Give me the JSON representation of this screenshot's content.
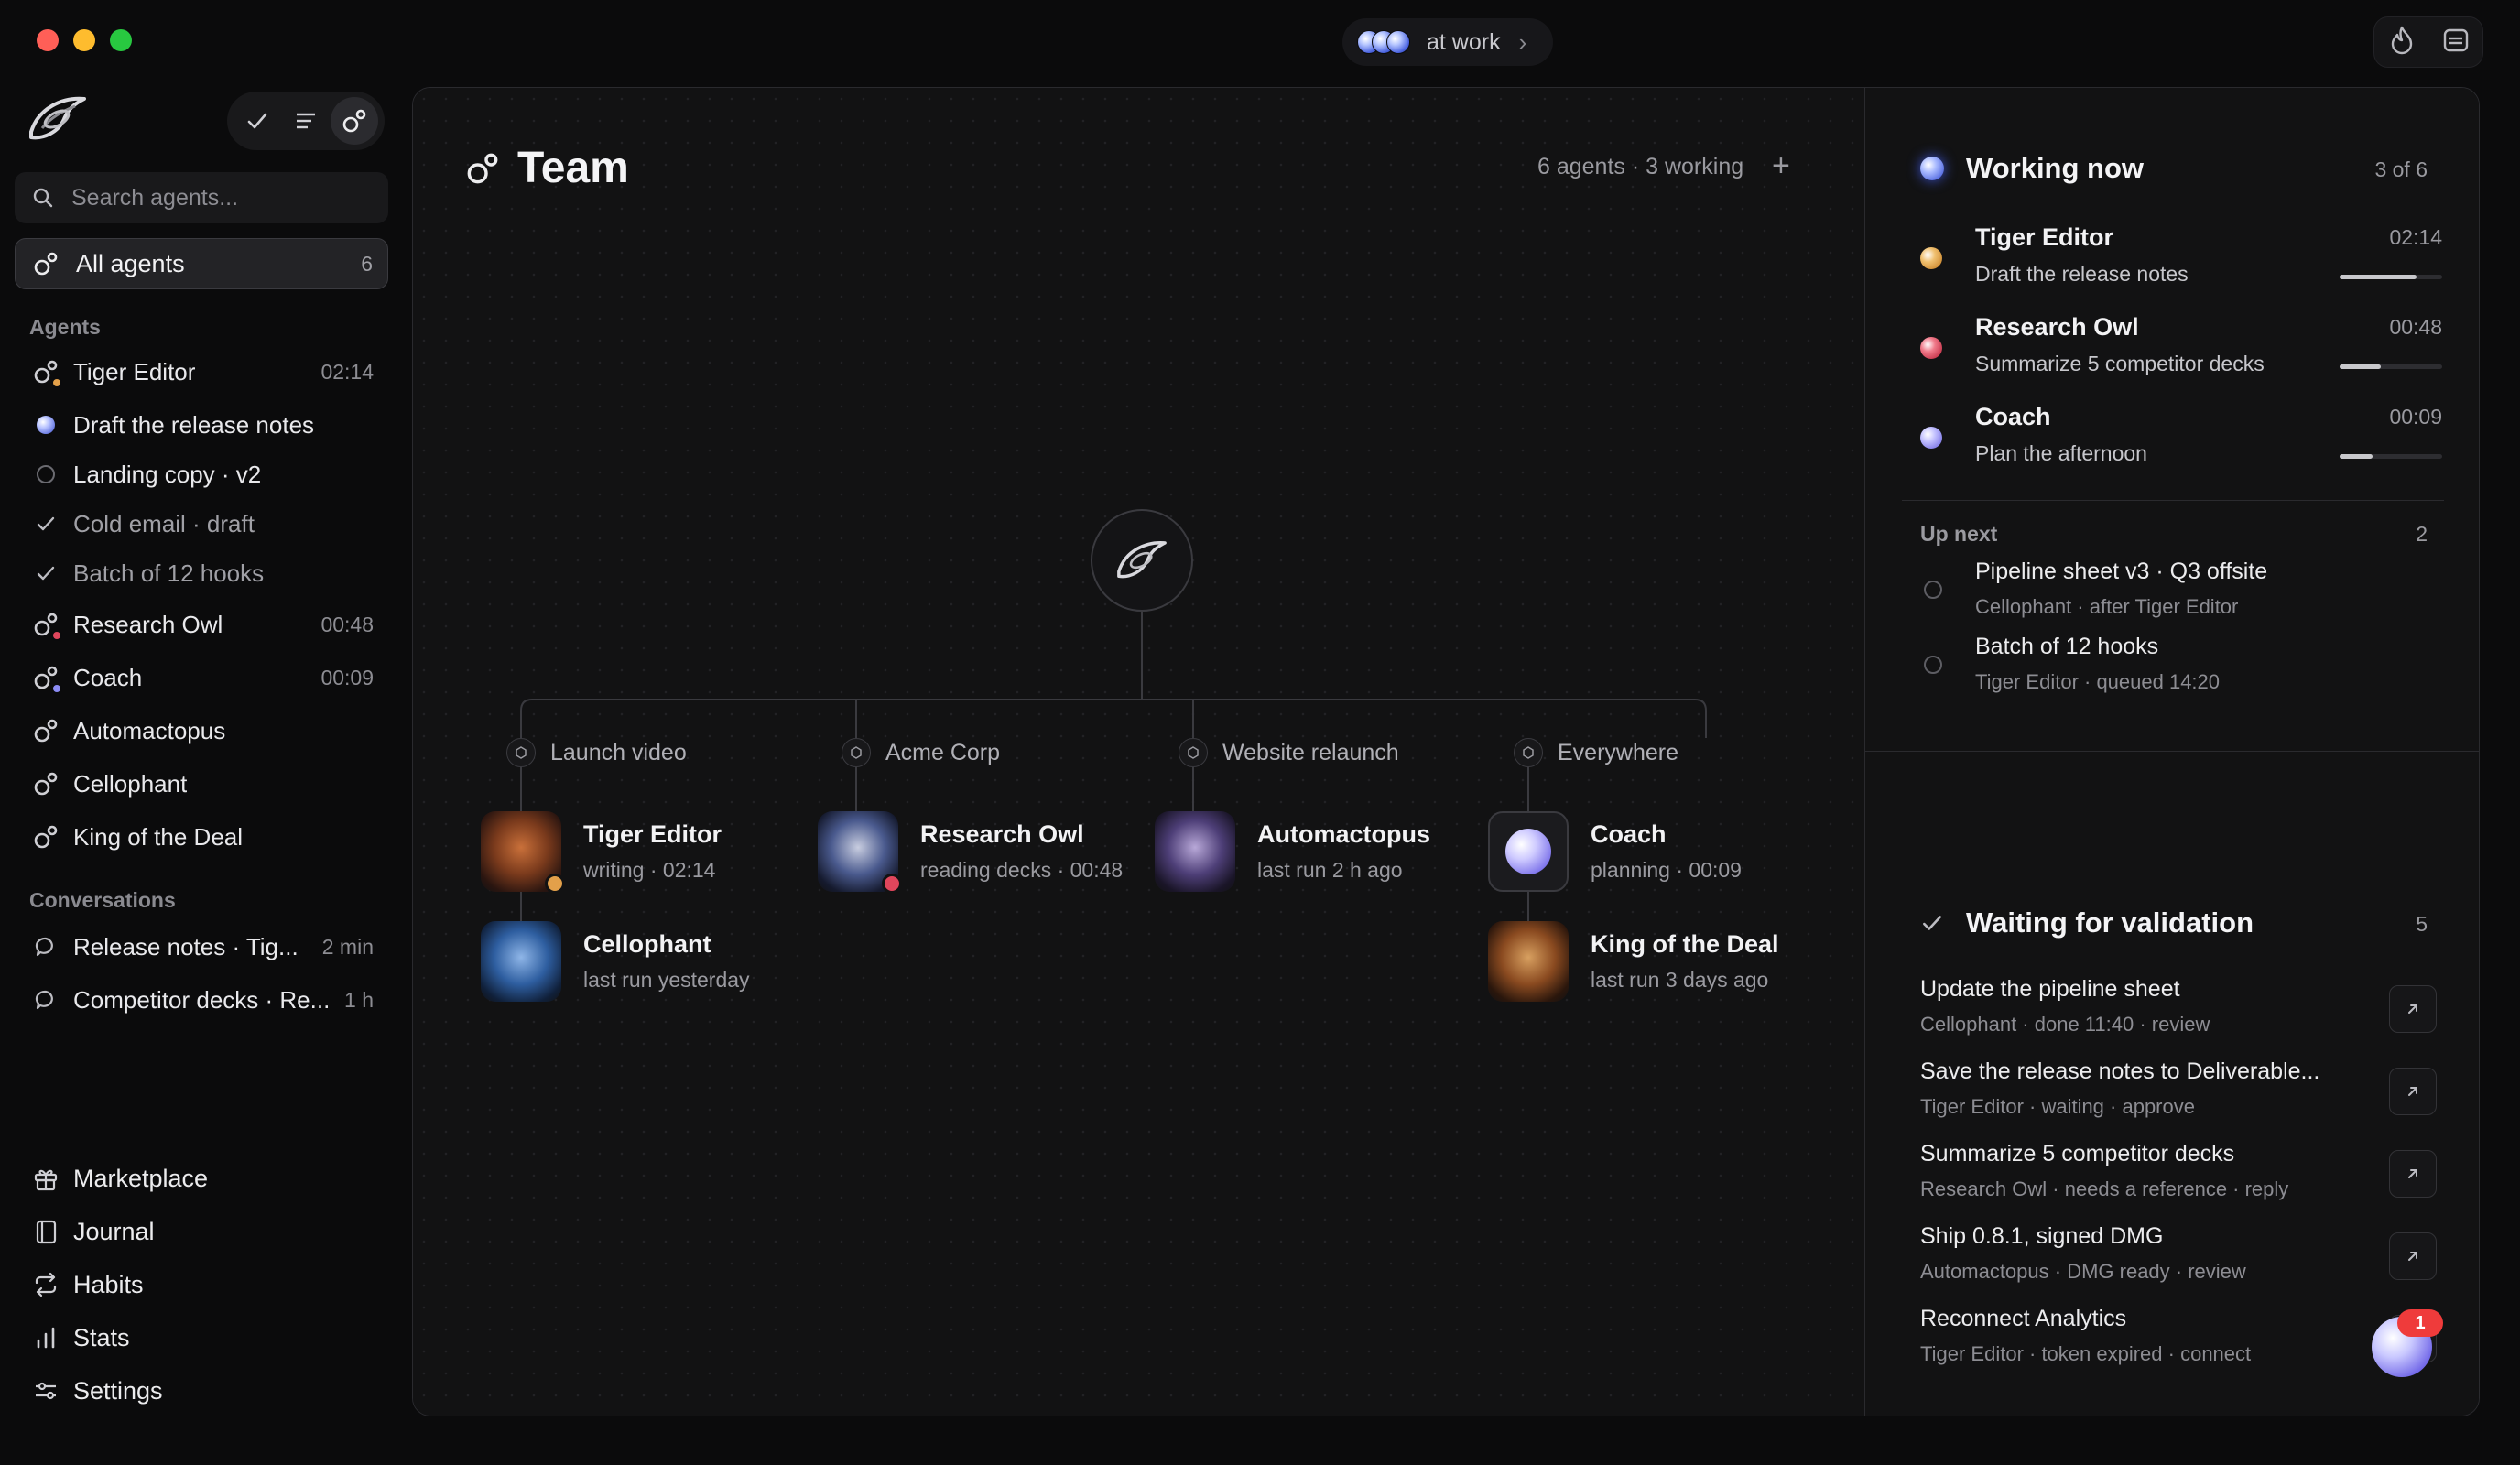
{
  "window": {
    "status_pill": {
      "label": "at work",
      "chevron": "›"
    }
  },
  "sidebar": {
    "search_placeholder": "Search agents...",
    "all_agents": {
      "label": "All agents",
      "count": "6"
    },
    "agents_section": "Agents",
    "agents": [
      {
        "label": "Tiger Editor",
        "time": "02:14",
        "icon": "agent-icon",
        "badge": "#e3a04a"
      },
      {
        "label": "Draft the release notes",
        "icon": "orb-icon",
        "badge": "#7f8ff7"
      },
      {
        "label": "Landing copy · v2",
        "icon": "circle-icon"
      },
      {
        "label": "Cold email · draft",
        "icon": "check-icon"
      },
      {
        "label": "Batch of 12 hooks",
        "icon": "check-icon"
      },
      {
        "label": "Research Owl",
        "time": "00:48",
        "icon": "agent-icon",
        "badge": "#e0465c"
      },
      {
        "label": "Coach",
        "time": "00:09",
        "icon": "agent-icon",
        "badge": "#8c8cf5"
      },
      {
        "label": "Automactopus",
        "icon": "agent-icon"
      },
      {
        "label": "Cellophant",
        "icon": "agent-icon"
      },
      {
        "label": "King of the Deal",
        "icon": "agent-icon"
      }
    ],
    "conversations_section": "Conversations",
    "conversations": [
      {
        "label": "Release notes · Tig...",
        "time": "2 min"
      },
      {
        "label": "Competitor decks · Re...",
        "time": "1 h"
      }
    ],
    "nav": [
      {
        "label": "Marketplace",
        "icon": "gift-icon"
      },
      {
        "label": "Journal",
        "icon": "book-icon"
      },
      {
        "label": "Habits",
        "icon": "repeat-icon"
      },
      {
        "label": "Stats",
        "icon": "bar-chart-icon"
      },
      {
        "label": "Settings",
        "icon": "sliders-icon"
      }
    ]
  },
  "team": {
    "title": "Team",
    "meta": "6 agents · 3 working",
    "add": "+",
    "groups": [
      {
        "label": "Launch video"
      },
      {
        "label": "Acme Corp"
      },
      {
        "label": "Website relaunch"
      },
      {
        "label": "Everywhere"
      }
    ],
    "agents": [
      {
        "name": "Tiger Editor",
        "status": "writing · 02:14",
        "badge": "#e3a04a"
      },
      {
        "name": "Cellophant",
        "status": "last run yesterday"
      },
      {
        "name": "Research Owl",
        "status": "reading decks · 00:48",
        "badge": "#e0465c"
      },
      {
        "name": "Automactopus",
        "status": "last run 2 h ago"
      },
      {
        "name": "Coach",
        "status": "planning · 00:09"
      },
      {
        "name": "King of the Deal",
        "status": "last run 3 days ago"
      }
    ]
  },
  "working_now": {
    "title": "Working now",
    "count": "3 of 6",
    "items": [
      {
        "name": "Tiger Editor",
        "task": "Draft the release notes",
        "time": "02:14",
        "progress": 0.75,
        "color": "#e3a04a"
      },
      {
        "name": "Research Owl",
        "task": "Summarize 5 competitor decks",
        "time": "00:48",
        "progress": 0.4,
        "color": "#e0465c"
      },
      {
        "name": "Coach",
        "task": "Plan the afternoon",
        "time": "00:09",
        "progress": 0.32,
        "color": "#9a9af5"
      }
    ]
  },
  "up_next": {
    "label": "Up next",
    "count": "2",
    "items": [
      {
        "name": "Pipeline sheet v3 · Q3 offsite",
        "sub": "Cellophant · after Tiger Editor"
      },
      {
        "name": "Batch of 12 hooks",
        "sub": "Tiger Editor · queued 14:20"
      }
    ]
  },
  "waiting_validation": {
    "title": "Waiting for validation",
    "count": "5",
    "items": [
      {
        "name": "Update the pipeline sheet",
        "sub": "Cellophant · done 11:40 · review"
      },
      {
        "name": "Save the release notes to Deliverable...",
        "sub": "Tiger Editor · waiting · approve"
      },
      {
        "name": "Summarize 5 competitor decks",
        "sub": "Research Owl · needs a reference · reply"
      },
      {
        "name": "Ship 0.8.1, signed DMG",
        "sub": "Automactopus · DMG ready · review"
      },
      {
        "name": "Reconnect Analytics",
        "sub": "Tiger Editor · token expired · connect"
      }
    ]
  },
  "fab": {
    "badge": "1"
  }
}
